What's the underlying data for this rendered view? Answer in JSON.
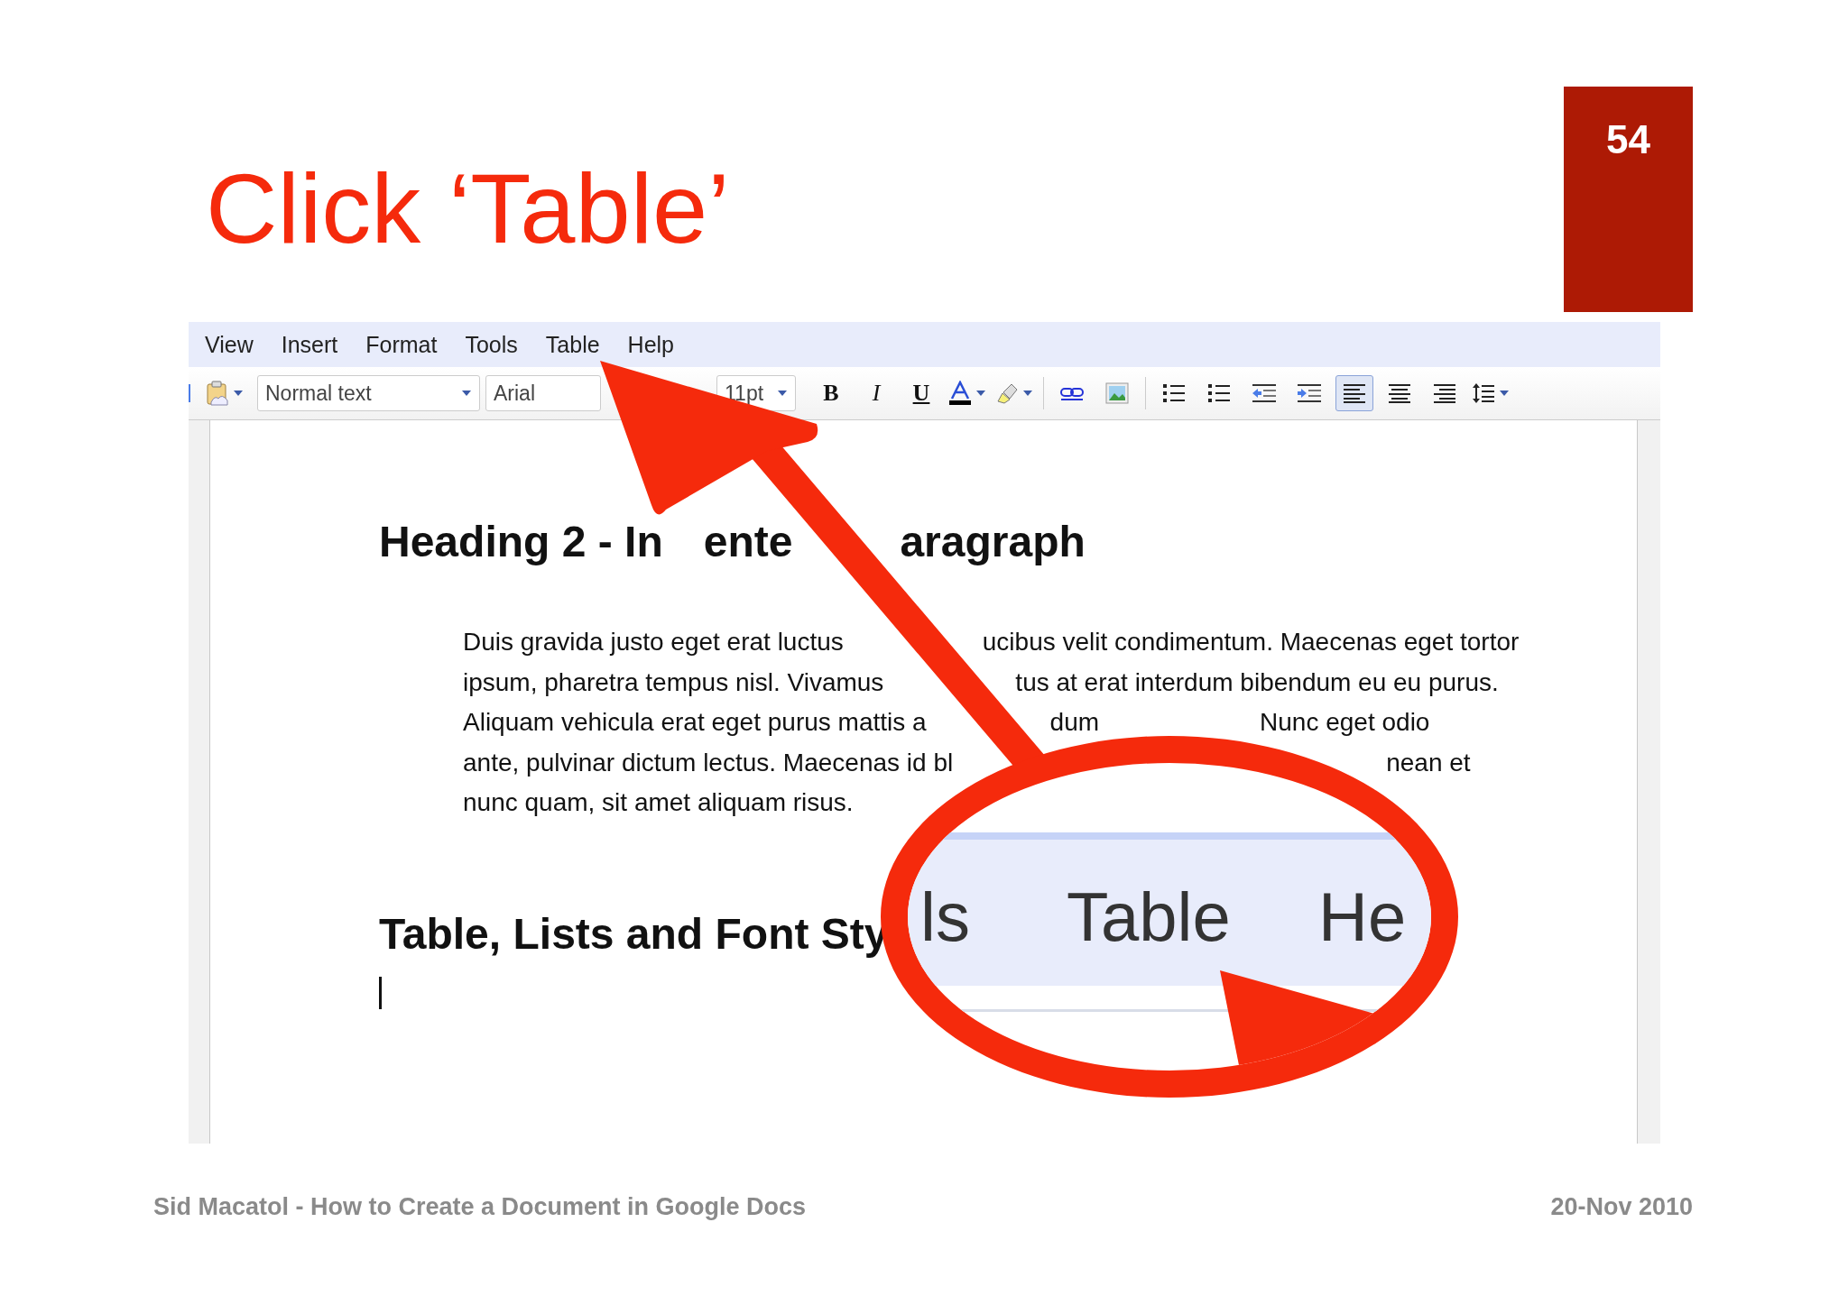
{
  "slide": {
    "title": "Click ‘Table’",
    "page_number": "54",
    "footer_left": "Sid Macatol - How to Create a Document in Google Docs",
    "footer_right": "20-Nov 2010"
  },
  "screenshot": {
    "menu": [
      {
        "label": "View"
      },
      {
        "label": "Insert"
      },
      {
        "label": "Format"
      },
      {
        "label": "Tools"
      },
      {
        "label": "Table"
      },
      {
        "label": "Help"
      }
    ],
    "toolbar": {
      "style": "Normal text",
      "font": "Arial",
      "size": "11pt",
      "buttons": [
        {
          "kind": "bold",
          "label": "B",
          "selected": false,
          "menu": false
        },
        {
          "kind": "italic",
          "label": "I",
          "selected": false,
          "menu": false
        },
        {
          "kind": "underline",
          "label": "U",
          "selected": false,
          "menu": false
        },
        {
          "kind": "text-color",
          "selected": false,
          "menu": true
        },
        {
          "kind": "highlight",
          "selected": false,
          "menu": true
        },
        {
          "kind": "separator"
        },
        {
          "kind": "link",
          "selected": false,
          "menu": false
        },
        {
          "kind": "image",
          "selected": false,
          "menu": false
        },
        {
          "kind": "separator"
        },
        {
          "kind": "numbered-list",
          "selected": false,
          "menu": false
        },
        {
          "kind": "bullet-list",
          "selected": false,
          "menu": false
        },
        {
          "kind": "outdent",
          "selected": false,
          "menu": false
        },
        {
          "kind": "indent",
          "selected": false,
          "menu": false
        },
        {
          "kind": "align-left",
          "selected": true,
          "menu": false
        },
        {
          "kind": "align-center",
          "selected": false,
          "menu": false
        },
        {
          "kind": "align-right",
          "selected": false,
          "menu": false
        },
        {
          "kind": "line-spacing",
          "selected": false,
          "menu": true
        }
      ]
    },
    "document": {
      "heading_1": [
        "Heading 2 - In",
        "ente",
        "aragraph"
      ],
      "paragraph": [
        [
          "Duis gravida justo eget erat luctus",
          "ucibus velit condimentum. Maecenas eget tortor"
        ],
        [
          "ipsum, pharetra tempus nisl. Vivamus",
          "tus at erat interdum bibendum eu eu purus."
        ],
        [
          "Aliquam vehicula erat eget purus mattis a",
          "dum",
          "Nunc eget odio"
        ],
        [
          "ante, pulvinar dictum lectus. Maecenas id bl",
          "nean et"
        ],
        [
          "nunc quam, sit amet aliquam risus."
        ]
      ],
      "heading_2": "Table, Lists and Font Sty"
    }
  },
  "magnifier": {
    "texts": [
      "ls",
      "Table",
      "He"
    ]
  }
}
